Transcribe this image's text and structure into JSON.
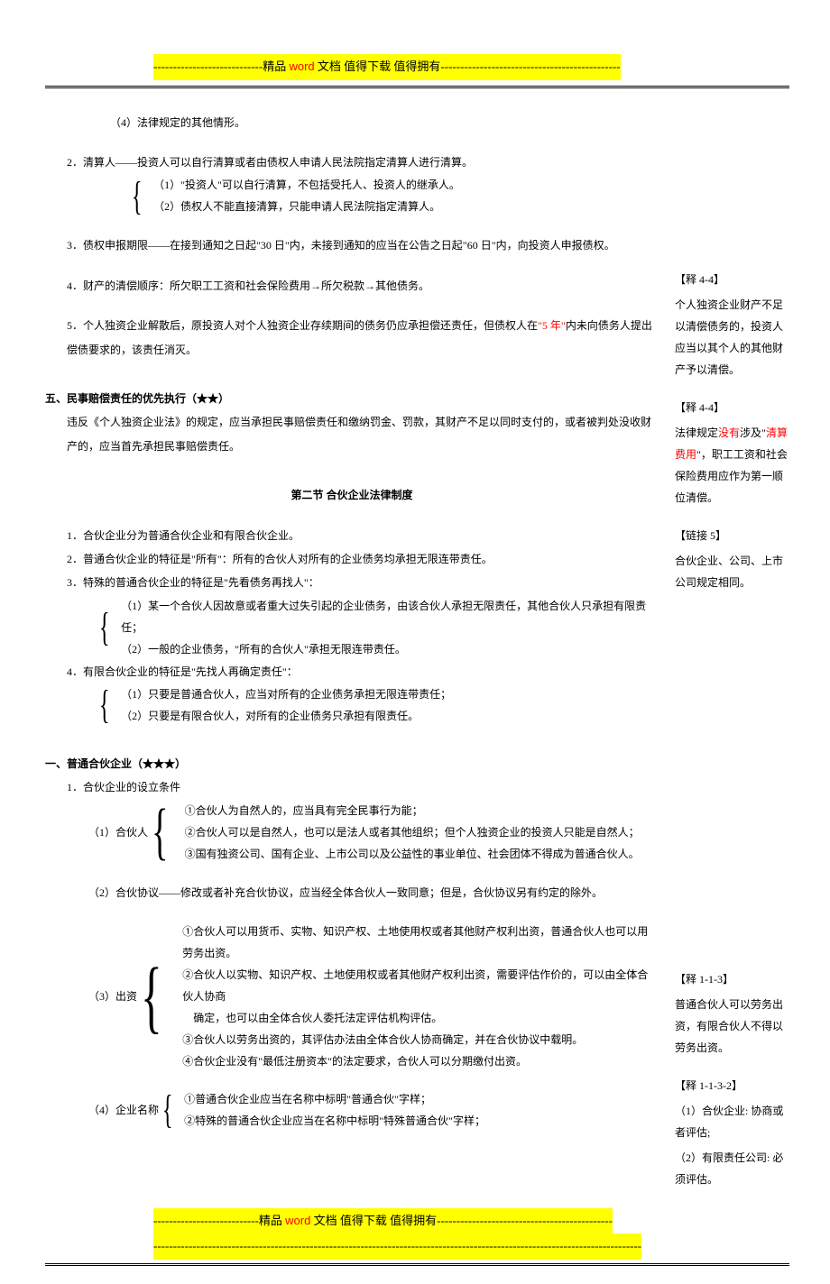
{
  "banner": {
    "dashes_left": "----------------------------",
    "prefix": "精品 ",
    "word": "word",
    "suffix": " 文档  值得下载   值得拥有",
    "dashes_right": "----------------------------------------------"
  },
  "footer_banner": {
    "dashes_left": "---------------------------",
    "prefix": "精品 ",
    "word": "word",
    "suffix": " 文档  值得下载   值得拥有",
    "dashes_right": "---------------------------------------------",
    "extra": "-----------------------------------------------------------------------------------------------------------------------------"
  },
  "main": {
    "p1": "（4）法律规定的其他情形。",
    "s2_title": "2．清算人——投资人可以自行清算或者由债权人申请人民法院指定清算人进行清算。",
    "s2_b1": "（1）\"投资人\"可以自行清算，不包括受托人、投资人的继承人。",
    "s2_b2": "（2）债权人不能直接清算，只能申请人民法院指定清算人。",
    "s3": "3．债权申报期限——在接到通知之日起\"30 日\"内，未接到通知的应当在公告之日起\"60 日\"内，向投资人申报债权。",
    "s4": "4．财产的清偿顺序：所欠职工工资和社会保险费用→所欠税款→其他债务。",
    "s5_a": "5．个人独资企业解散后，原投资人对个人独资企业存续期间的债务仍应承担偿还责任，但债权人在",
    "s5_red": "\"5 年\"",
    "s5_b": "内未向债务人提出偿债要求的，该责任消灭。",
    "h5_title": "五、民事赔偿责任的优先执行（★★）",
    "h5_body": "违反《个人独资企业法》的规定，应当承担民事赔偿责任和缴纳罚金、罚款，其财产不足以同时支付的，或者被判处没收财产的，应当首先承担民事赔偿责任。",
    "section2_title": "第二节   合伙企业法律制度",
    "l1": "1．合伙企业分为普通合伙企业和有限合伙企业。",
    "l2": "2．普通合伙企业的特征是\"所有\"：所有的合伙人对所有的企业债务均承担无限连带责任。",
    "l3": "3．特殊的普通合伙企业的特征是\"先看债务再找人\"：",
    "l3_b1": "（1）某一个合伙人因故意或者重大过失引起的企业债务，由该合伙人承担无限责任，其他合伙人只承担有限责任；",
    "l3_b2": "（2）一般的企业债务，\"所有的合伙人\"承担无限连带责任。",
    "l4": "4．有限合伙企业的特征是\"先找人再确定责任\"：",
    "l4_b1": "（1）只要是普通合伙人，应当对所有的企业债务承担无限连带责任；",
    "l4_b2": "（2）只要是有限合伙人，对所有的企业债务只承担有限责任。",
    "h1_title": "一、普通合伙企业（★★★）",
    "h1_1": "1．合伙企业的设立条件",
    "c1_label": "（1）合伙人",
    "c1_1": "①合伙人为自然人的，应当具有完全民事行为能；",
    "c1_2": "②合伙人可以是自然人，也可以是法人或者其他组织；但个人独资企业的投资人只能是自然人；",
    "c1_3": "③国有独资公司、国有企业、上市公司以及公益性的事业单位、社会团体不得成为普通合伙人。",
    "c2": "（2）合伙协议——修改或者补充合伙协议，应当经全体合伙人一致同意；但是，合伙协议另有约定的除外。",
    "c3_label": "（3）出资",
    "c3_1": "①合伙人可以用货币、实物、知识产权、土地使用权或者其他财产权利出资，普通合伙人也可以用劳务出资。",
    "c3_2a": "②合伙人以实物、知识产权、土地使用权或者其他财产权利出资，需要评估作价的，可以由全体合伙人协商",
    "c3_2b": "确定，也可以由全体合伙人委托法定评估机构评估。",
    "c3_3": "③合伙人以劳务出资的，其评估办法由全体合伙人协商确定，并在合伙协议中载明。",
    "c3_4": "④合伙企业没有\"最低注册资本\"的法定要求，合伙人可以分期缴付出资。",
    "c4_label": "（4）企业名称",
    "c4_1": "①普通合伙企业应当在名称中标明\"普通合伙\"字样；",
    "c4_2": "②特殊的普通合伙企业应当在名称中标明\"特殊普通合伙\"字样；"
  },
  "side": {
    "r1_t": "【释 4-4】",
    "r1_b": "个人独资企业财产不足以清偿债务的，投资人应当以其个人的其他财产予以清偿。",
    "r2_t": "【释 4-4】",
    "r2_a": "法律规定",
    "r2_red1": "没有",
    "r2_b": "涉及\"",
    "r2_red2": "清算费用",
    "r2_c": "\"，职工工资和社会保险费用应作为第一顺位清偿。",
    "r3_t": "【链接 5】",
    "r3_b": "合伙企业、公司、上市公司规定相同。",
    "r4_t": "【释 1-1-3】",
    "r4_b": "普通合伙人可以劳务出资，有限合伙人不得以劳务出资。",
    "r5_t": "【释 1-1-3-2】",
    "r5_1": "（1）合伙企业: 协商或者评估;",
    "r5_2": "（2）有限责任公司: 必须评估。"
  }
}
